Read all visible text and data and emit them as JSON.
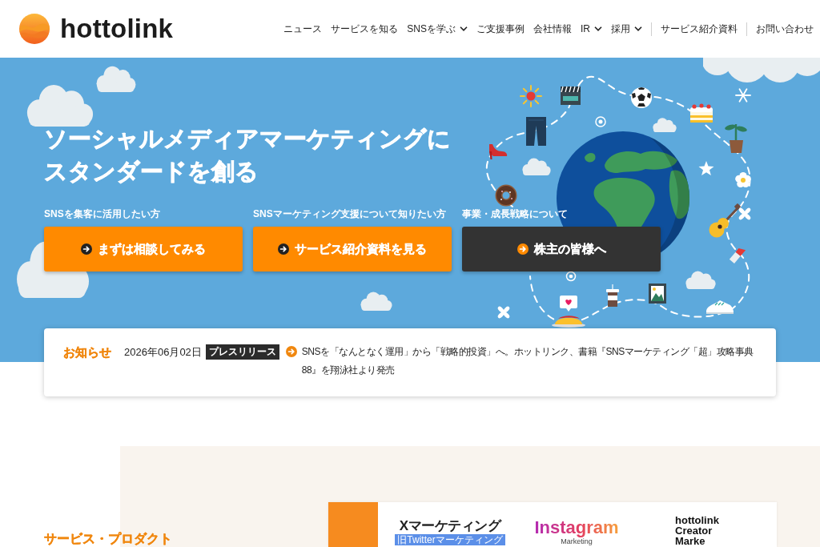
{
  "header": {
    "logo": "hottolink",
    "nav": [
      {
        "label": "ニュース",
        "kind": "link"
      },
      {
        "label": "サービスを知る",
        "kind": "link"
      },
      {
        "label": "SNSを学ぶ",
        "kind": "dropdown"
      },
      {
        "label": "ご支援事例",
        "kind": "link"
      },
      {
        "label": "会社情報",
        "kind": "link"
      },
      {
        "label": "IR",
        "kind": "dropdown"
      },
      {
        "label": "採用",
        "kind": "dropdown"
      },
      {
        "label": "サービス紹介資料",
        "kind": "separated"
      },
      {
        "label": "お問い合わせ",
        "kind": "separated"
      }
    ]
  },
  "hero": {
    "headline": [
      "ソーシャルメディアマーケティングに",
      "スタンダードを創る"
    ],
    "ctas": [
      {
        "caption": "SNSを集客に活用したい方",
        "label": "まずは相談してみる",
        "kind": "primary"
      },
      {
        "caption": "SNSマーケティング支援について知りたい方",
        "label": "サービス紹介資料を見る",
        "kind": "primary"
      },
      {
        "caption": "事業・成長戦略について",
        "label": "株主の皆様へ",
        "kind": "dark"
      }
    ]
  },
  "news": {
    "heading": "お知らせ",
    "items": [
      {
        "date": "2026年06月02日",
        "tag": "プレスリリース",
        "title": "SNSを「なんとなく運用」から「戦略的投資」へ。ホットリンク、書籍『SNSマーケティング「超」攻略事典88』を翔泳社より発売"
      }
    ]
  },
  "services": {
    "heading": "サービス・プロダクト",
    "logos": [
      {
        "kind": "x",
        "title": "Xマーケティング",
        "badge": "旧Twitterマーケティング"
      },
      {
        "kind": "instagram",
        "title": "Instagram",
        "subtitle": "Marketing"
      },
      {
        "kind": "wordmark",
        "lines": [
          "hottolink",
          "Creator",
          "Marke"
        ]
      }
    ]
  }
}
